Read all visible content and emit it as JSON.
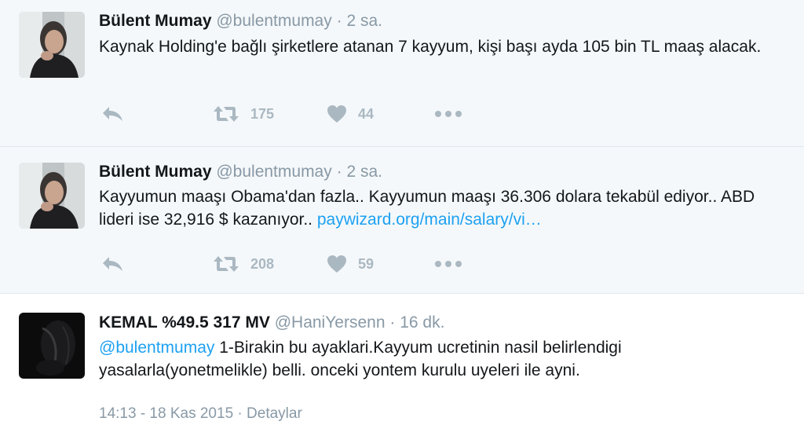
{
  "tweets": [
    {
      "name": "Bülent Mumay",
      "handle": "@bulentmumay",
      "separator": "·",
      "time": "2 sa.",
      "text": "Kaynak Holding'e bağlı şirketlere atanan 7 kayyum, kişi başı ayda 105 bin TL maaş alacak.",
      "retweets": "175",
      "likes": "44"
    },
    {
      "name": "Bülent Mumay",
      "handle": "@bulentmumay",
      "separator": "·",
      "time": "2 sa.",
      "text": "Kayyumun maaşı Obama'dan fazla.. Kayyumun maaşı 36.306 dolara tekabül ediyor.. ABD lideri ise 32,916 $ kazanıyor.. ",
      "link": "paywizard.org/main/salary/vi…",
      "retweets": "208",
      "likes": "59"
    },
    {
      "name": "KEMAL %49.5 317 MV",
      "handle": "@HaniYersenn",
      "separator": "·",
      "time": "16 dk.",
      "mention": "@bulentmumay",
      "text": " 1-Birakin bu ayaklari.Kayyum ucretinin nasil belirlendigi yasalarla(yonetmelikle) belli. onceki yontem kurulu uyeleri ile ayni.",
      "timestamp": "14:13 - 18 Kas 2015",
      "details_separator": "·",
      "details_label": "Detaylar"
    }
  ],
  "colors": {
    "accent": "#1da1f2",
    "muted": "#8899a6",
    "icon": "#aab8c2",
    "bg_grey": "#f5f8fa"
  },
  "icons": [
    "reply-icon",
    "retweet-icon",
    "heart-icon",
    "more-icon"
  ]
}
